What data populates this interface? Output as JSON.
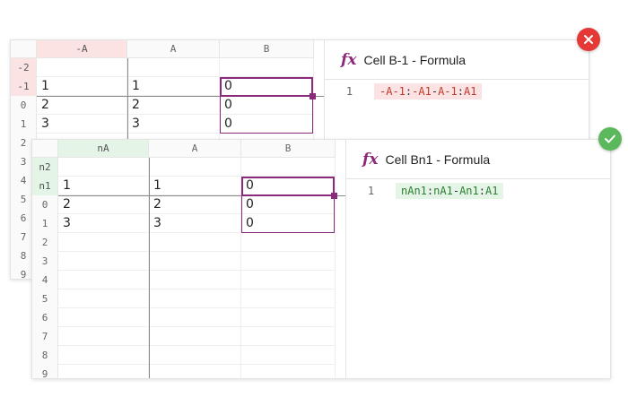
{
  "colors": {
    "bad": "#e53935",
    "good": "#5cb85c",
    "accent": "#8b2a7b"
  },
  "icons": {
    "bad_badge": "cross-icon",
    "good_badge": "check-icon",
    "formula": "fx-icon"
  },
  "bad": {
    "formula_title": "Cell B-1 - Formula",
    "fx_symbol": "fx",
    "line_number": "1",
    "formula_parts": [
      "-A-1",
      ":",
      "-A1",
      "-",
      "A-1",
      ":",
      "A1"
    ],
    "column_headers": [
      "-A",
      "A",
      "B"
    ],
    "row_headers": [
      "-2",
      "-1",
      "0",
      "1",
      "2",
      "3",
      "4",
      "5",
      "6",
      "7",
      "8",
      "9"
    ],
    "rows": [
      [
        "",
        "",
        ""
      ],
      [
        "1",
        "1",
        "0"
      ],
      [
        "2",
        "2",
        "0"
      ],
      [
        "3",
        "3",
        "0"
      ]
    ]
  },
  "good": {
    "formula_title": "Cell Bn1 - Formula",
    "fx_symbol": "fx",
    "line_number": "1",
    "formula_parts": [
      "nAn1",
      ":",
      "nA1",
      "-",
      "An1",
      ":",
      "A1"
    ],
    "column_headers": [
      "nA",
      "A",
      "B"
    ],
    "row_headers": [
      "n2",
      "n1",
      "0",
      "1",
      "2",
      "3",
      "4",
      "5",
      "6",
      "7",
      "8",
      "9"
    ],
    "rows": [
      [
        "",
        "",
        ""
      ],
      [
        "1",
        "1",
        "0"
      ],
      [
        "2",
        "2",
        "0"
      ],
      [
        "3",
        "3",
        "0"
      ]
    ]
  }
}
